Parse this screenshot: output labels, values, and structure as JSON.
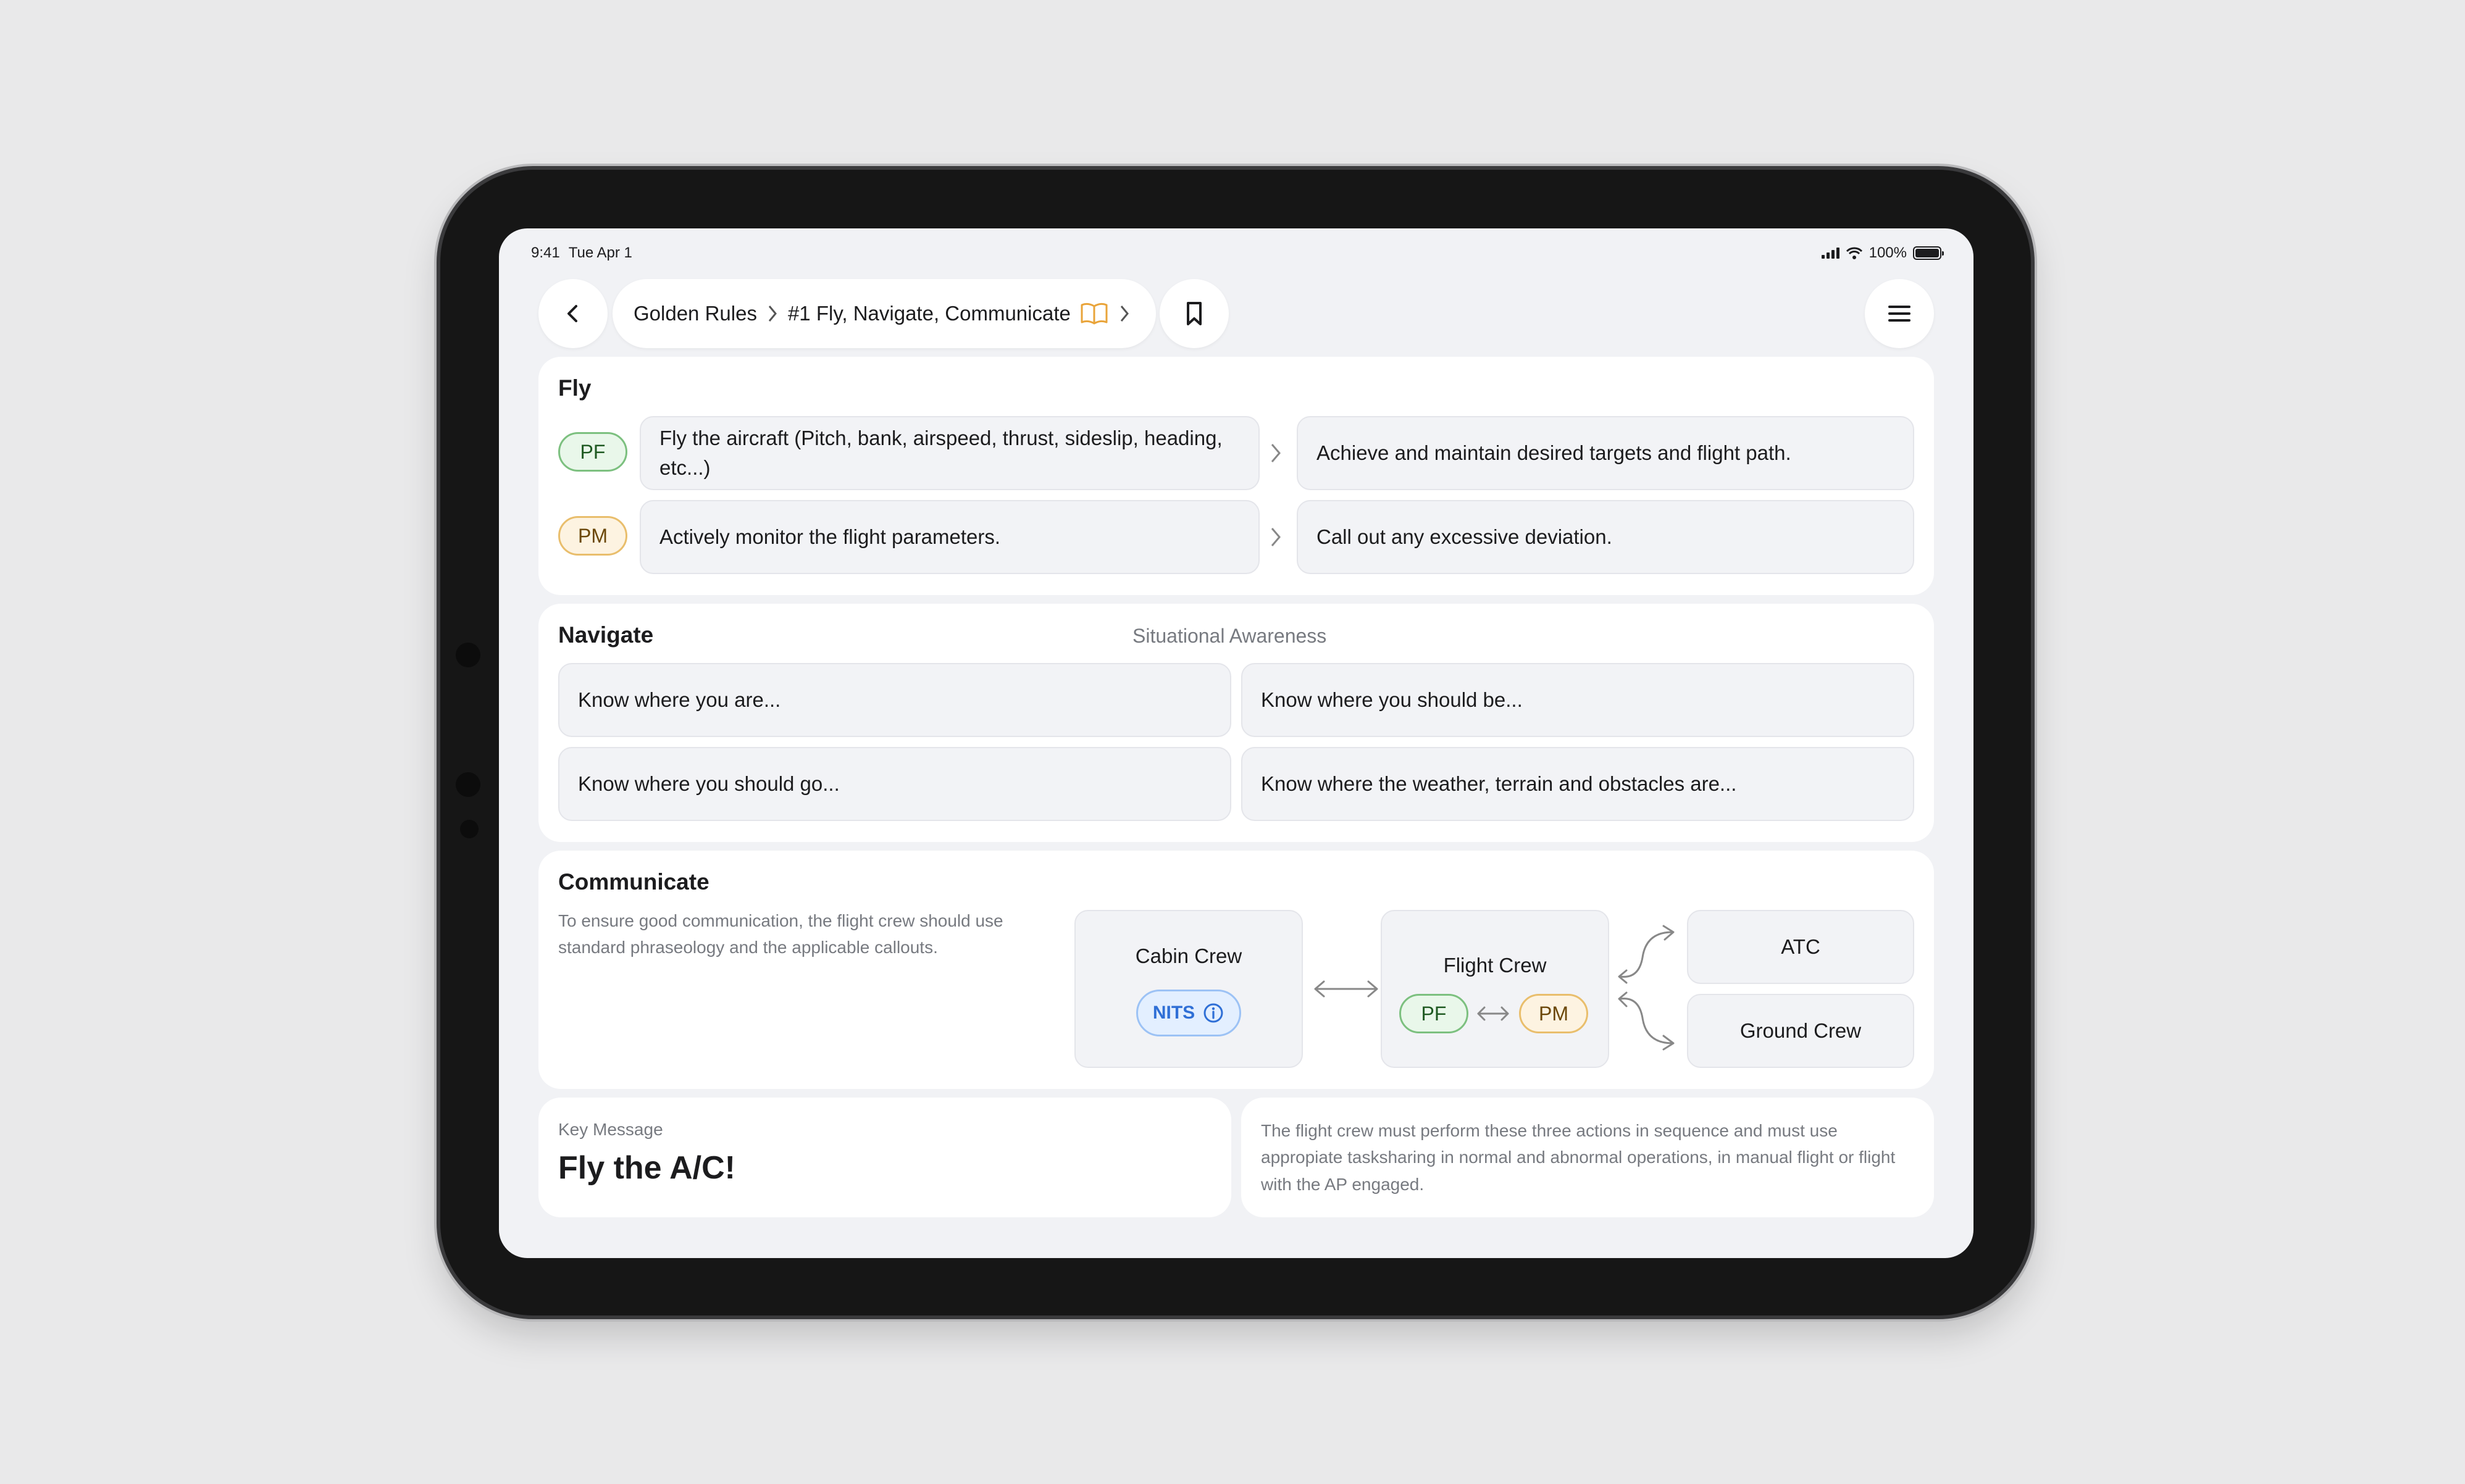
{
  "status_bar": {
    "time": "9:41",
    "date": "Tue Apr 1",
    "battery": "100%",
    "battery_level": 1.0
  },
  "breadcrumb": {
    "items": [
      "Golden Rules",
      "#1 Fly, Navigate, Communicate"
    ]
  },
  "fly": {
    "title": "Fly",
    "rows": [
      {
        "role": "PF",
        "action": "Fly the aircraft (Pitch, bank, airspeed, thrust, sideslip, heading, etc...)",
        "result": "Achieve and maintain desired targets and flight path."
      },
      {
        "role": "PM",
        "action": "Actively monitor the flight parameters.",
        "result": "Call out any excessive deviation."
      }
    ]
  },
  "navigate": {
    "title": "Navigate",
    "subtitle": "Situational Awareness",
    "items": [
      "Know where you are...",
      "Know where you should be...",
      "Know where you should go...",
      "Know where the weather, terrain and obstacles are..."
    ]
  },
  "communicate": {
    "title": "Communicate",
    "description": "To ensure good communication, the flight crew should use standard phraseology and the applicable callouts.",
    "cabin_crew": {
      "label": "Cabin Crew",
      "badge": "NITS"
    },
    "flight_crew": {
      "label": "Flight Crew",
      "pf": "PF",
      "pm": "PM"
    },
    "external": [
      "ATC",
      "Ground Crew"
    ]
  },
  "key_message": {
    "label": "Key Message",
    "title": "Fly the A/C!",
    "body": "The flight crew must perform these three actions in sequence and must use appropiate tasksharing in normal and abnormal operations, in manual flight or flight with the AP engaged."
  },
  "colors": {
    "pf_border": "#7cc07f",
    "pm_border": "#e9be6c",
    "nits_blue": "#2f6fd6",
    "book_orange": "#e9a43a"
  }
}
